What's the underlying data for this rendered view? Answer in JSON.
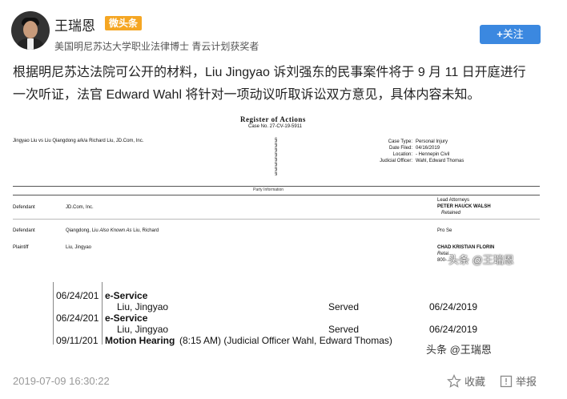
{
  "header": {
    "author_name": "王瑞恩",
    "badge": "微头条",
    "subtitle": "美国明尼苏达大学职业法律博士 青云计划获奖者",
    "follow_label": "关注",
    "follow_plus": "+"
  },
  "post": {
    "line1": "根据明尼苏达法院可公开的材料，Liu Jingyao 诉刘强东的民事案件将于 9 月 11 日开庭进行",
    "line2": "一次听证，法官 Edward Wahl 将针对一项动议听取诉讼双方意见，具体内容未知。"
  },
  "document": {
    "title": "Register of Actions",
    "case_no": "Case No. 27-CV-19-5911",
    "caption": "Jingyao Liu vs Liu Qiangdong a/k/a Richard Liu, JD.Com, Inc.",
    "meta_labels": [
      "Case Type:",
      "Date Filed:",
      "Location:",
      "Judicial Officer:"
    ],
    "meta_values": [
      "Personal Injury",
      "04/16/2019",
      "- Hennepin Civil",
      "Wahl, Edward Thomas"
    ],
    "section_header": "Party Information",
    "lead_attorneys_label": "Lead Attorneys",
    "parties": [
      {
        "role": "Defendant",
        "name": "JD.Com, Inc.",
        "attorney": "PETER HAUCK WALSH",
        "attorney_note": "Retained"
      },
      {
        "role": "Defendant",
        "name_a": "Qiangdong, Liu",
        "aka": "Also Known As",
        "name_b": "Liu, Richard",
        "attorney": "Pro Se",
        "attorney_note": ""
      },
      {
        "role": "Plaintiff",
        "name": "Liu, Jingyao",
        "attorney": "CHAD KRISTIAN FLORIN",
        "attorney_note": "Retai…",
        "attorney_phone": "800-…"
      }
    ]
  },
  "events": [
    {
      "date": "06/24/201",
      "event": "e-Service",
      "party": "Liu, Jingyao",
      "status": "Served",
      "served_date": "06/24/2019"
    },
    {
      "date": "06/24/201",
      "event": "e-Service",
      "party": "Liu, Jingyao",
      "status": "Served",
      "served_date": "06/24/2019"
    },
    {
      "date": "09/11/201",
      "event": "Motion Hearing",
      "detail": "(8:15 AM) (Judicial Officer Wahl, Edward Thomas)"
    }
  ],
  "watermarks": [
    "头条 @王瑞恩",
    "头条 @王瑞恩"
  ],
  "footer": {
    "timestamp": "2019-07-09 16:30:22",
    "favorite_label": "收藏",
    "report_label": "举报"
  },
  "colors": {
    "follow_bg": "#3b88e0",
    "badge_bg": "#f5a623"
  }
}
